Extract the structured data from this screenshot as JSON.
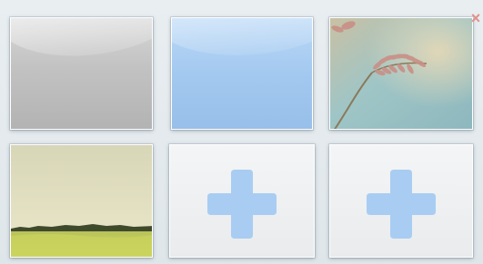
{
  "wallpaper_grid": {
    "tiles": [
      {
        "kind": "swatch",
        "color": "#c2c2c2",
        "icon": null
      },
      {
        "kind": "swatch",
        "color": "#a4c9f0",
        "icon": null
      },
      {
        "kind": "photo",
        "subject": "dandelion-flower-photo",
        "icon": "remove-icon"
      },
      {
        "kind": "photo",
        "subject": "grass-field-photo",
        "icon": null
      },
      {
        "kind": "add",
        "icon": "plus-icon",
        "color": "#a9cdf2"
      },
      {
        "kind": "add",
        "icon": "plus-icon",
        "color": "#a9cdf2"
      }
    ],
    "remove_glyph": "×",
    "remove_color": "#e2908c"
  }
}
